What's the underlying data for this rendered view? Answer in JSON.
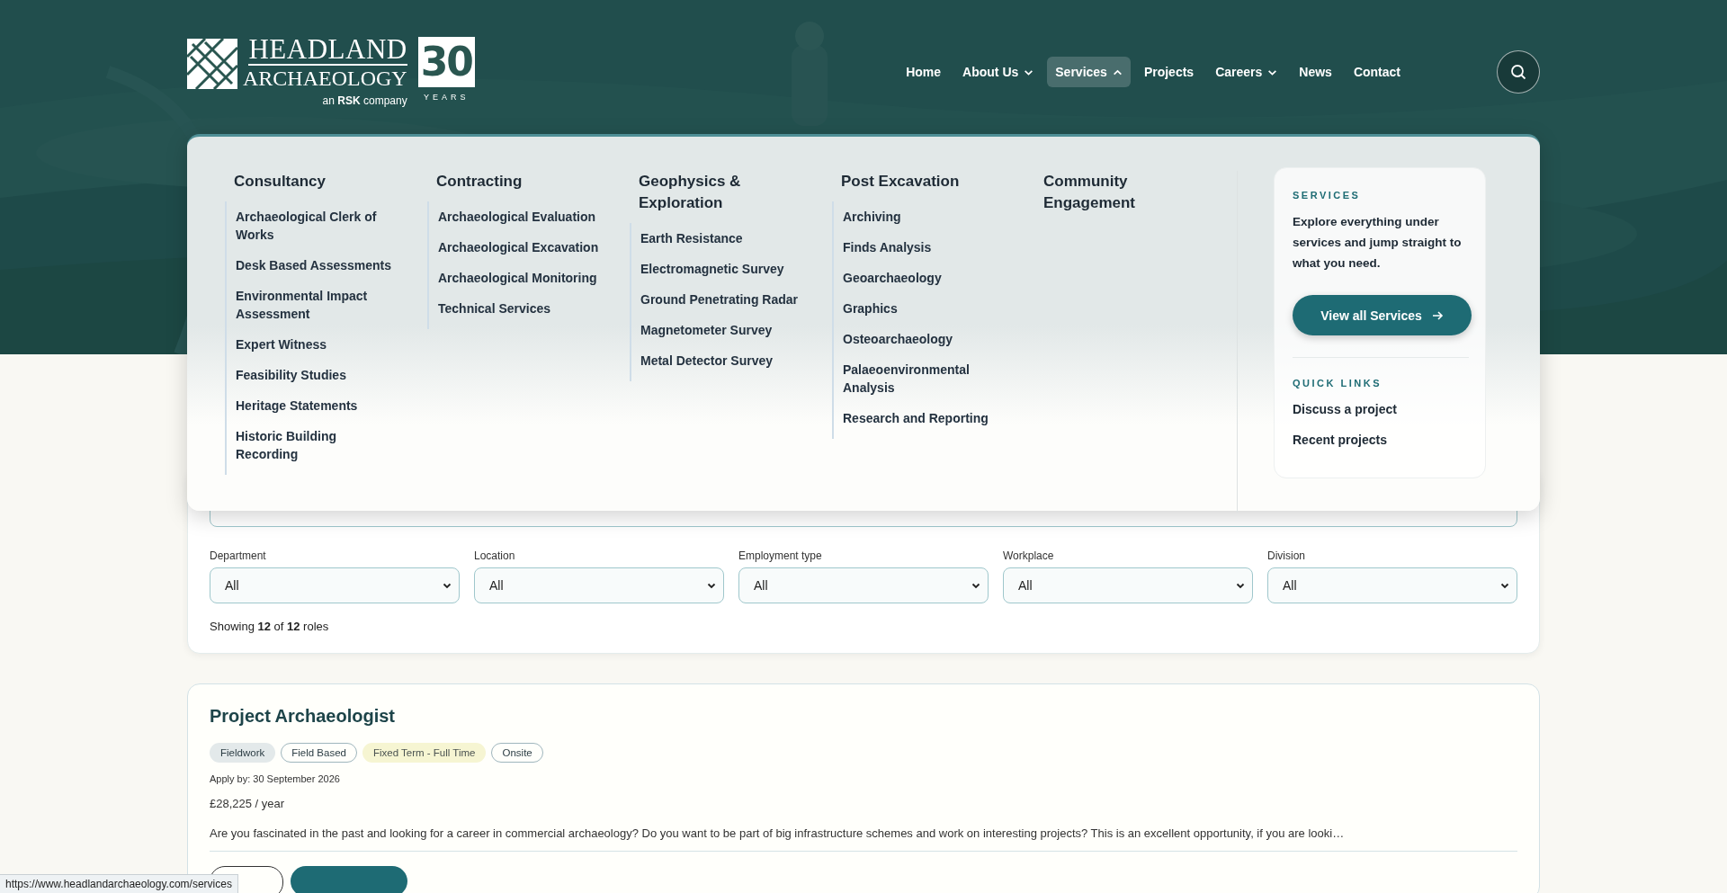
{
  "logo": {
    "line_1": "HEADLAND",
    "line_2": "ARCHAEOLOGY",
    "tagline": "an **RSK** company",
    "anniversary": "30",
    "anniversary_label": "YEARS"
  },
  "nav": [
    {
      "label": "Home",
      "has_menu": false,
      "expanded": false
    },
    {
      "label": "About Us",
      "has_menu": true,
      "expanded": false
    },
    {
      "label": "Services",
      "has_menu": true,
      "expanded": true
    },
    {
      "label": "Projects",
      "has_menu": false,
      "expanded": false
    },
    {
      "label": "Careers",
      "has_menu": true,
      "expanded": false
    },
    {
      "label": "News",
      "has_menu": false,
      "expanded": false
    },
    {
      "label": "Contact",
      "has_menu": false,
      "expanded": false
    }
  ],
  "mega_menu": {
    "columns": [
      {
        "heading": "Consultancy",
        "links": [
          "Archaeological Clerk of Works",
          "Desk Based Assessments",
          "Environmental Impact Assessment",
          "Expert Witness",
          "Feasibility Studies",
          "Heritage Statements",
          "Historic Building Recording"
        ]
      },
      {
        "heading": "Contracting",
        "links": [
          "Archaeological Evaluation",
          "Archaeological Excavation",
          "Archaeological Monitoring",
          "Technical Services"
        ]
      },
      {
        "heading": "Geophysics & Exploration",
        "links": [
          "Earth Resistance",
          "Electromagnetic Survey",
          "Ground Penetrating Radar",
          "Magnetometer Survey",
          "Metal Detector Survey"
        ]
      },
      {
        "heading": "Post Excavation",
        "links": [
          "Archiving",
          "Finds Analysis",
          "Geoarchaeology",
          "Graphics",
          "Osteoarchaeology",
          "Palaeoenvironmental Analysis",
          "Research and Reporting"
        ]
      },
      {
        "heading": "Community Engagement"
      }
    ],
    "side_card": {
      "eyebrow": "SERVICES",
      "text": "Explore everything under services and jump straight to what you need.",
      "button": "View all Services",
      "quick_links_heading": "QUICK LINKS",
      "quick_links": [
        "Discuss a project",
        "Recent projects"
      ]
    }
  },
  "filters": [
    {
      "label": "Department",
      "value": "All"
    },
    {
      "label": "Location",
      "value": "All"
    },
    {
      "label": "Employment type",
      "value": "All"
    },
    {
      "label": "Workplace",
      "value": "All"
    },
    {
      "label": "Division",
      "value": "All"
    }
  ],
  "results_count": "Showing **12** of **12** roles",
  "job": {
    "title": "Project Archaeologist",
    "tags": [
      {
        "label": "Fieldwork",
        "kind": "filled"
      },
      {
        "label": "Field Based",
        "kind": "outline"
      },
      {
        "label": "Fixed Term - Full Time",
        "kind": "highlight"
      },
      {
        "label": "Onsite",
        "kind": "outline"
      }
    ],
    "apply_by": "Apply by: 30 September 2026",
    "salary": "£28,225 / year",
    "description": "Are you fascinated in the past and looking for a career in commercial archaeology? Do you want to be part of big infrastructure schemes and work on interesting projects? This is an excellent opportunity, if you are looki…"
  },
  "status_bar": {
    "url": "https://www.headlandarchaeology.com/services"
  }
}
